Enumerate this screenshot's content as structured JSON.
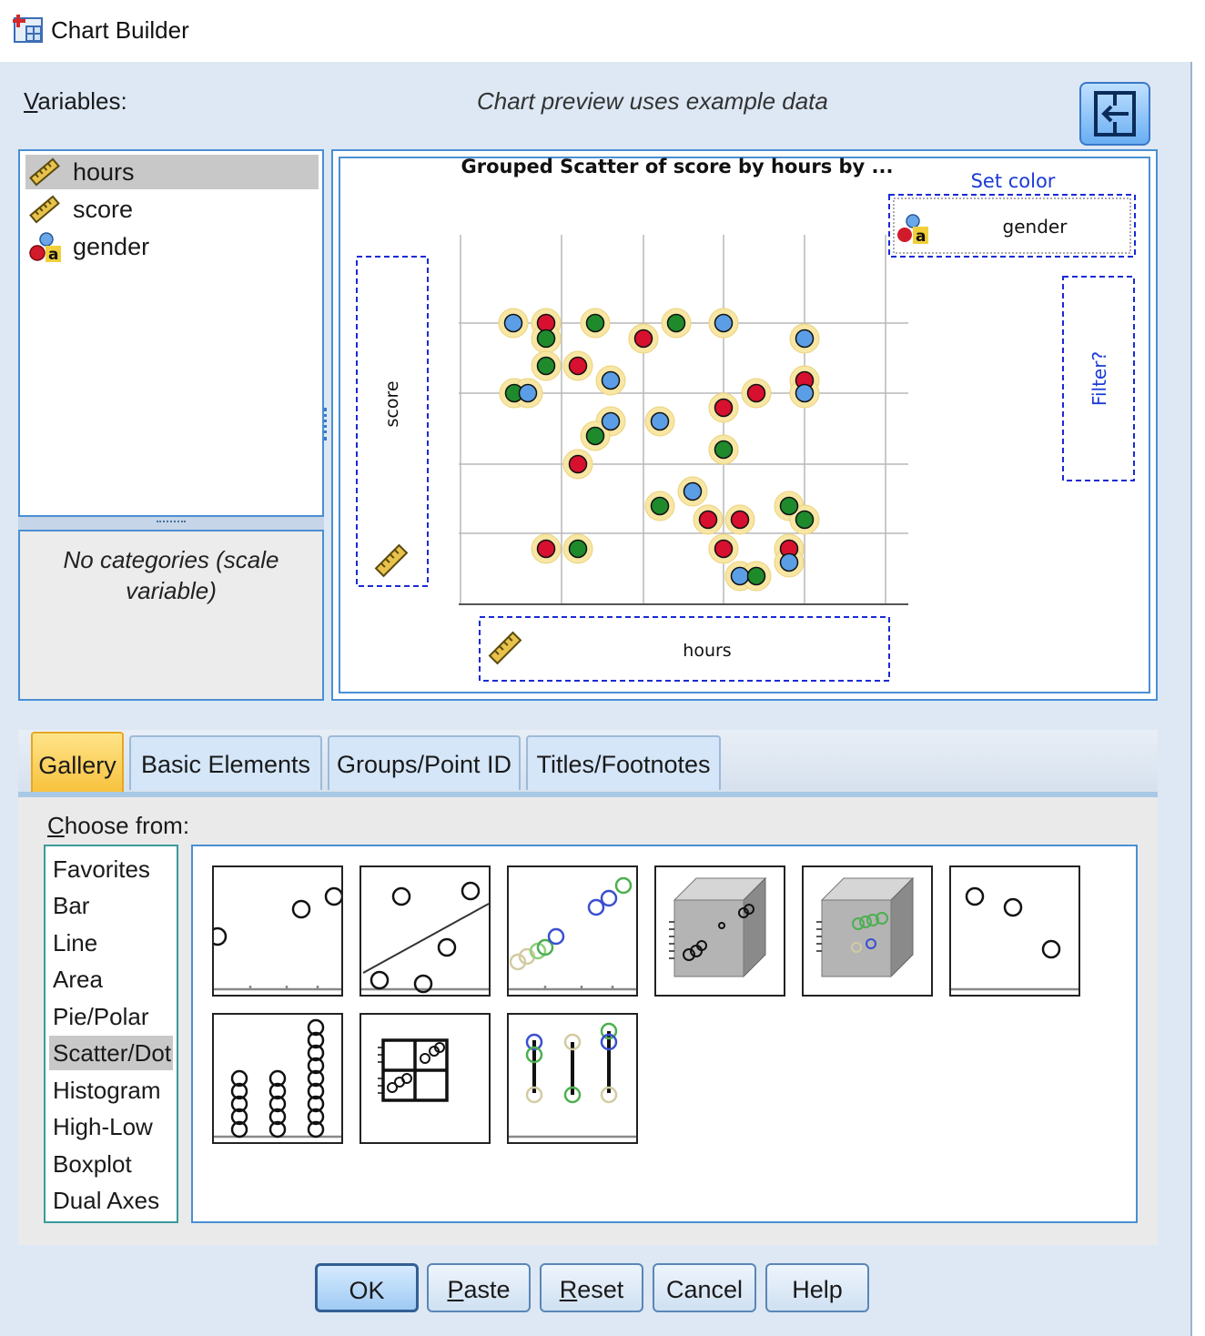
{
  "window": {
    "title": "Chart Builder"
  },
  "header": {
    "variables_label_first": "V",
    "variables_label_rest": "ariables:",
    "preview_caption": "Chart preview uses example data"
  },
  "variables": [
    {
      "name": "hours",
      "type": "scale",
      "icon": "ruler-icon",
      "selected": true
    },
    {
      "name": "score",
      "type": "scale",
      "icon": "ruler-icon",
      "selected": false
    },
    {
      "name": "gender",
      "type": "nominal",
      "icon": "nominal-variable-icon",
      "selected": false
    }
  ],
  "categories_box": {
    "line1": "No categories (scale",
    "line2": "variable)"
  },
  "preview": {
    "title": "Grouped Scatter of score by hours by ...",
    "set_color_label": "Set color",
    "color_drop_value": "gender",
    "y_drop_value": "score",
    "x_drop_value": "hours",
    "filter_label": "Filter?",
    "point_colors": {
      "blue": "#5b9ee6",
      "red": "#d6102e",
      "green": "#1e8a2c",
      "halo": "#f7e6a4"
    }
  },
  "tabs": [
    {
      "label": "Gallery",
      "active": true
    },
    {
      "label": "Basic Elements",
      "active": false
    },
    {
      "label": "Groups/Point ID",
      "active": false
    },
    {
      "label": "Titles/Footnotes",
      "active": false
    }
  ],
  "gallery": {
    "choose_label_first": "C",
    "choose_label_rest": "hoose from:",
    "chart_types": [
      "Favorites",
      "Bar",
      "Line",
      "Area",
      "Pie/Polar",
      "Scatter/Dot",
      "Histogram",
      "High-Low",
      "Boxplot",
      "Dual Axes"
    ],
    "selected_chart_type": "Scatter/Dot",
    "thumbnails": [
      "simple-scatter-icon",
      "scatter-fit-line-icon",
      "grouped-scatter-icon",
      "simple-3d-scatter-icon",
      "grouped-3d-scatter-icon",
      "summary-point-icon",
      "simple-dot-plot-icon",
      "scatterplot-matrix-icon",
      "drop-line-icon"
    ]
  },
  "buttons": {
    "ok": "OK",
    "paste_first": "P",
    "paste_rest": "aste",
    "reset_first": "R",
    "reset_rest": "eset",
    "cancel": "Cancel",
    "help": "Help"
  }
}
